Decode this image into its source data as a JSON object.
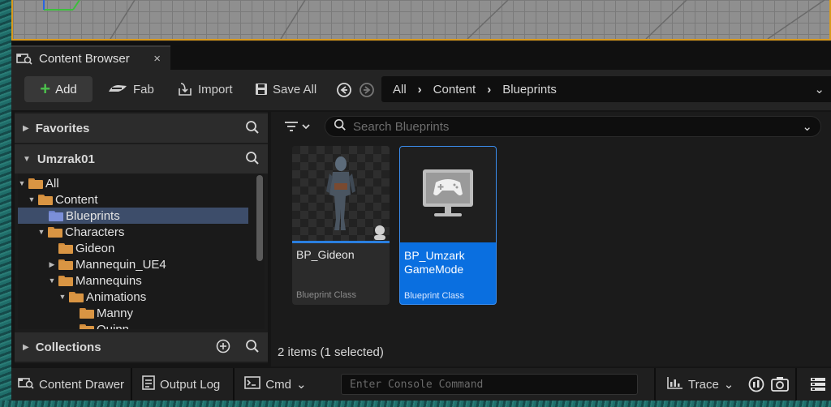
{
  "tab": {
    "label": "Content Browser",
    "close": "×"
  },
  "toolbar": {
    "add": "Add",
    "fab": "Fab",
    "import": "Import",
    "save_all": "Save All"
  },
  "path": [
    "All",
    "Content",
    "Blueprints"
  ],
  "left": {
    "favorites": "Favorites",
    "project": "Umzrak01",
    "collections": "Collections",
    "tree": [
      {
        "label": "All",
        "expanded": true,
        "selected": false
      },
      {
        "label": "Content",
        "expanded": true,
        "selected": false
      },
      {
        "label": "Blueprints",
        "expanded": false,
        "selected": true
      },
      {
        "label": "Characters",
        "expanded": true,
        "selected": false
      },
      {
        "label": "Gideon",
        "expanded": false,
        "selected": false
      },
      {
        "label": "Mannequin_UE4",
        "expanded": false,
        "selected": false
      },
      {
        "label": "Mannequins",
        "expanded": true,
        "selected": false
      },
      {
        "label": "Animations",
        "expanded": true,
        "selected": false
      },
      {
        "label": "Manny",
        "expanded": false,
        "selected": false
      },
      {
        "label": "Quinn",
        "expanded": false,
        "selected": false
      }
    ]
  },
  "search": {
    "placeholder": "Search Blueprints"
  },
  "assets": [
    {
      "name": "BP_Gideon",
      "class": "Blueprint Class",
      "selected": false
    },
    {
      "name": "BP_Umzark GameMode",
      "class": "Blueprint Class",
      "selected": true
    }
  ],
  "status": "2 items (1 selected)",
  "statusbar": {
    "content_drawer": "Content Drawer",
    "output_log": "Output Log",
    "cmd": "Cmd",
    "console_placeholder": "Enter Console Command",
    "trace": "Trace"
  },
  "colors": {
    "accent": "#0a6fe0",
    "add_plus": "#4cc14c",
    "viewport_border": "#d99a1e"
  }
}
